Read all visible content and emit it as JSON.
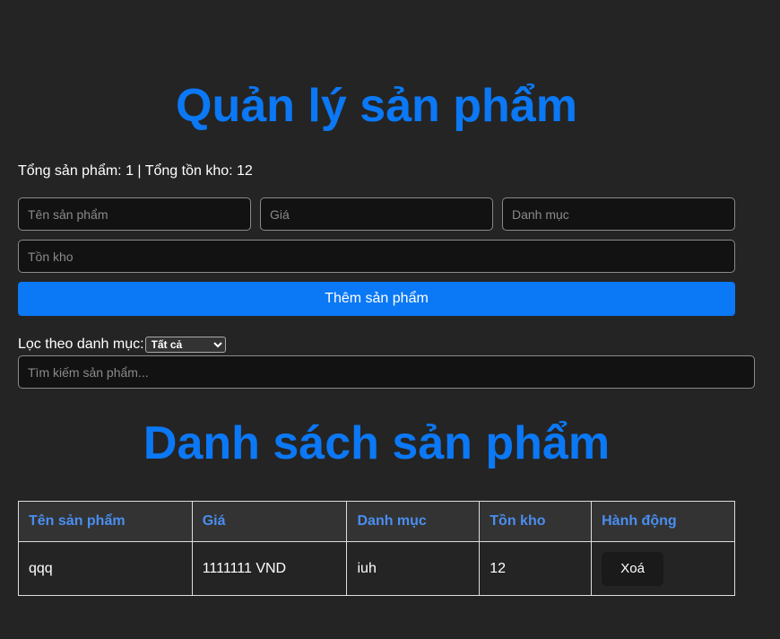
{
  "header": {
    "title": "Quản lý sản phẩm"
  },
  "summary": {
    "text": "Tổng sản phẩm: 1 | Tổng tồn kho: 12"
  },
  "form": {
    "name_placeholder": "Tên sản phẩm",
    "price_placeholder": "Giá",
    "category_placeholder": "Danh mục",
    "stock_placeholder": "Tồn kho",
    "add_button": "Thêm sản phẩm"
  },
  "filter": {
    "label": "Lọc theo danh mục:",
    "selected": "Tất cả",
    "search_placeholder": "Tìm kiếm sản phẩm..."
  },
  "list": {
    "title": "Danh sách sản phẩm",
    "columns": [
      "Tên sản phẩm",
      "Giá",
      "Danh mục",
      "Tồn kho",
      "Hành động"
    ],
    "rows": [
      {
        "name": "qqq",
        "price": "1111111 VND",
        "category": "iuh",
        "stock": "12",
        "action": "Xoá"
      }
    ]
  }
}
